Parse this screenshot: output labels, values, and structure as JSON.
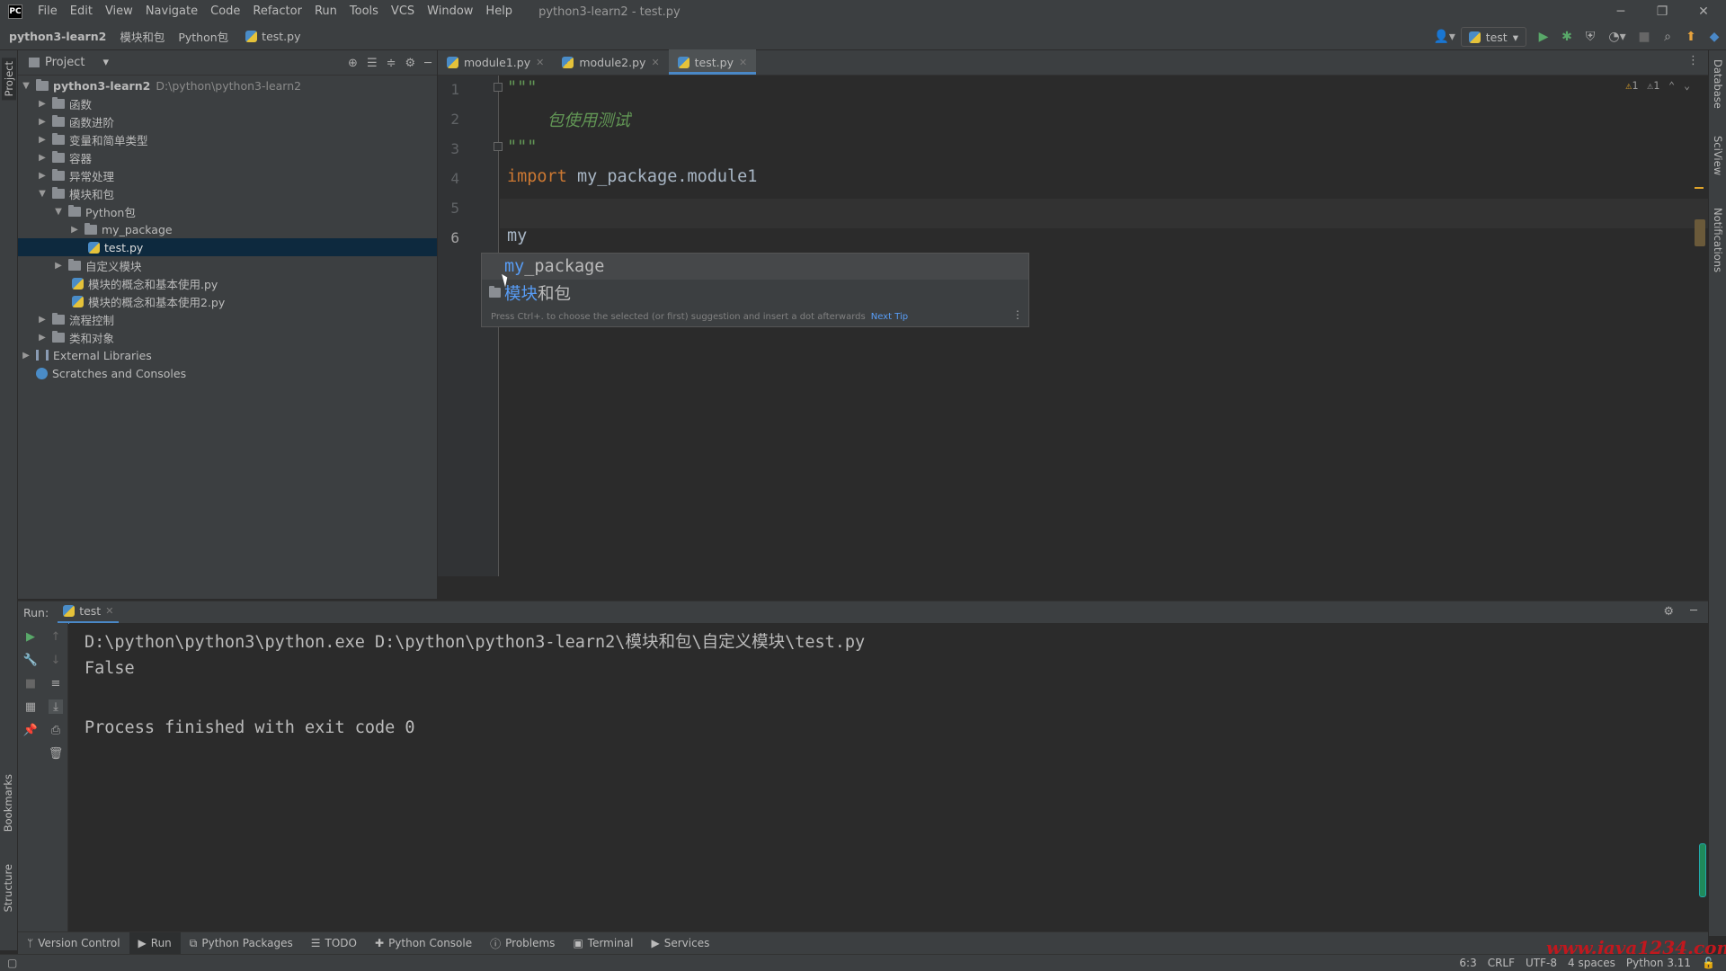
{
  "titlebar": {
    "logo": "PC",
    "menu": [
      "File",
      "Edit",
      "View",
      "Navigate",
      "Code",
      "Refactor",
      "Run",
      "Tools",
      "VCS",
      "Window",
      "Help"
    ],
    "window_title": "python3-learn2 - test.py"
  },
  "navbar": {
    "crumbs": [
      "python3-learn2",
      "模块和包",
      "Python包",
      "test.py"
    ],
    "run_config": "test"
  },
  "project": {
    "title": "Project",
    "tree": [
      {
        "label": "python3-learn2",
        "hint": "D:\\python\\python3-learn2"
      },
      {
        "label": "函数"
      },
      {
        "label": "函数进阶"
      },
      {
        "label": "变量和简单类型"
      },
      {
        "label": "容器"
      },
      {
        "label": "异常处理"
      },
      {
        "label": "模块和包"
      },
      {
        "label": "Python包"
      },
      {
        "label": "my_package"
      },
      {
        "label": "test.py"
      },
      {
        "label": "自定义模块"
      },
      {
        "label": "模块的概念和基本使用.py"
      },
      {
        "label": "模块的概念和基本使用2.py"
      },
      {
        "label": "流程控制"
      },
      {
        "label": "类和对象"
      },
      {
        "label": "External Libraries"
      },
      {
        "label": "Scratches and Consoles"
      }
    ]
  },
  "editor": {
    "tabs": [
      {
        "label": "module1.py"
      },
      {
        "label": "module2.py"
      },
      {
        "label": "test.py"
      }
    ],
    "line_numbers": [
      "1",
      "2",
      "3",
      "4",
      "5",
      "6"
    ],
    "lines": [
      "\"\"\"",
      "    包使用测试",
      "\"\"\"",
      "import my_package.module1",
      "",
      "my"
    ],
    "import_kw": "import",
    "import_rest": " my_package.module1",
    "warnings": [
      "1",
      "1"
    ]
  },
  "completion": {
    "items": [
      {
        "hl": "my",
        "rest": "_package"
      },
      {
        "hl": "模块",
        "rest": "和包"
      }
    ],
    "tip": "Press Ctrl+. to choose the selected (or first) suggestion and insert a dot afterwards",
    "next_tip": "Next Tip"
  },
  "run": {
    "label": "Run:",
    "tab": "test",
    "output": [
      "D:\\python\\python3\\python.exe D:\\python\\python3-learn2\\模块和包\\自定义模块\\test.py",
      "False",
      "",
      "Process finished with exit code 0"
    ]
  },
  "stripes": {
    "left": [
      "Project",
      "Bookmarks",
      "Structure"
    ],
    "right": [
      "Database",
      "SciView",
      "Notifications"
    ]
  },
  "toolwindows": [
    "Version Control",
    "Run",
    "Python Packages",
    "TODO",
    "Python Console",
    "Problems",
    "Terminal",
    "Services"
  ],
  "status": [
    "6:3",
    "CRLF",
    "UTF-8",
    "4 spaces",
    "Python 3.11"
  ],
  "watermark": "www.java1234.com"
}
